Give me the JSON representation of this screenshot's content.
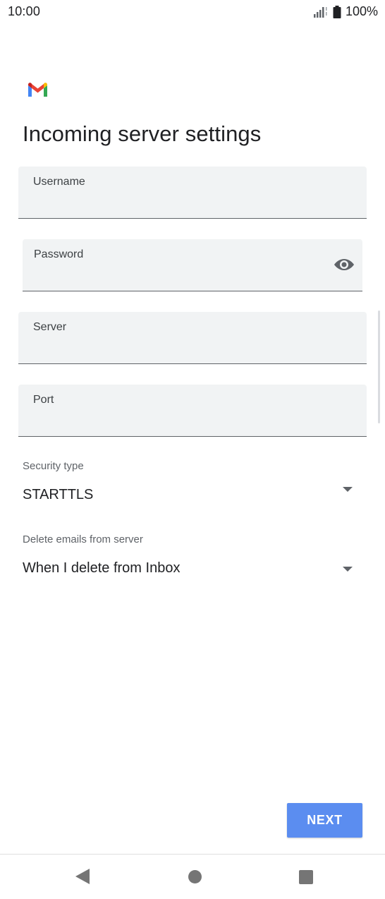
{
  "status_bar": {
    "time": "10:00",
    "battery": "100%",
    "icons": [
      "signal-icon",
      "battery-icon"
    ]
  },
  "app": {
    "logo": "gmail-logo",
    "title": "Incoming server settings"
  },
  "fields": {
    "username": {
      "label": "Username",
      "value": ""
    },
    "password": {
      "label": "Password",
      "value": "",
      "toggle_icon": "eye-icon"
    },
    "server": {
      "label": "Server",
      "value": ""
    },
    "port": {
      "label": "Port",
      "value": ""
    }
  },
  "selects": {
    "security_type": {
      "label": "Security type",
      "value": "STARTTLS"
    },
    "delete_emails": {
      "label": "Delete emails from server",
      "value": "When I delete from Inbox"
    }
  },
  "actions": {
    "next_label": "NEXT"
  },
  "nav": {
    "icons": [
      "back-icon",
      "home-icon",
      "recents-icon"
    ]
  },
  "colors": {
    "accent": "#5b8df0",
    "field_bg": "#f1f3f4",
    "text": "#202124"
  }
}
